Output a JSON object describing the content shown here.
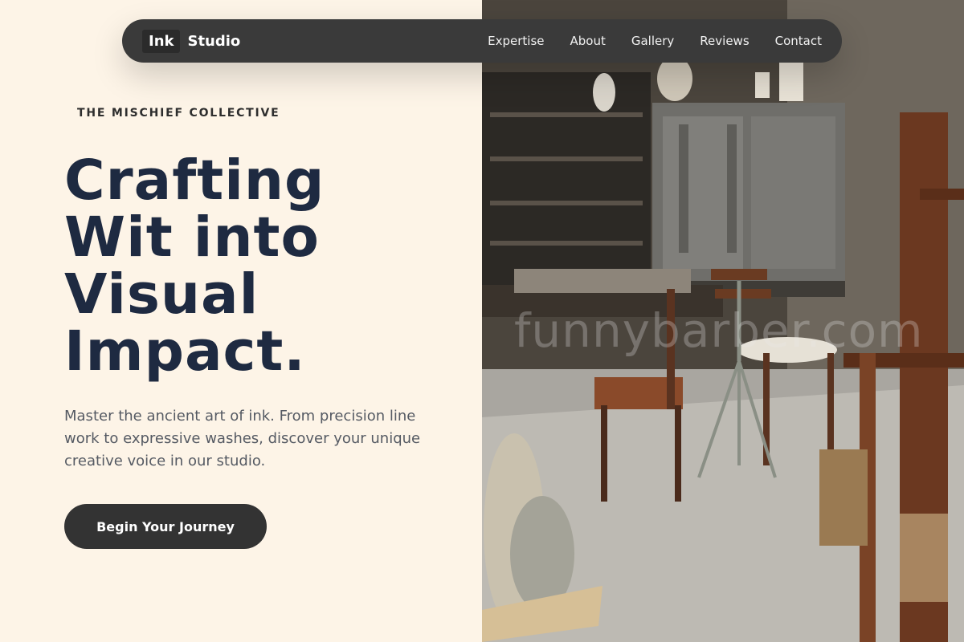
{
  "nav": {
    "logo_box": "Ink",
    "logo_text": "Studio",
    "links": [
      "Expertise",
      "About",
      "Gallery",
      "Reviews",
      "Contact"
    ]
  },
  "hero": {
    "eyebrow": "THE MISCHIEF COLLECTIVE",
    "headline_lines": [
      "Crafting",
      "Wit into",
      "Visual",
      "Impact."
    ],
    "description": "Master the ancient art of ink. From precision line work to expressive washes, discover your unique creative voice in our studio.",
    "cta_label": "Begin Your Journey"
  },
  "photo": {
    "watermark": "funnybarber.com"
  },
  "colors": {
    "background": "#fdf4e7",
    "nav_bg": "#3a3a3a",
    "headline": "#1e2a41",
    "cta_bg": "#333333"
  }
}
